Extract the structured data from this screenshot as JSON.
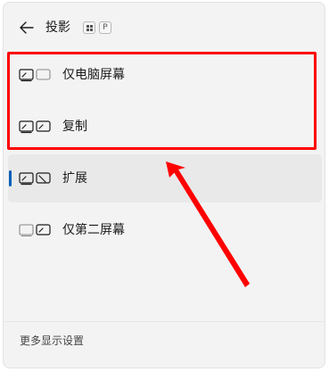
{
  "header": {
    "title": "投影",
    "back_icon": "back-arrow-icon",
    "shortcut_keys": [
      "Win",
      "P"
    ]
  },
  "items": [
    {
      "label": "仅电脑屏幕",
      "icon": "pc-screen-only-icon",
      "selected": false
    },
    {
      "label": "复制",
      "icon": "duplicate-icon",
      "selected": false
    },
    {
      "label": "扩展",
      "icon": "extend-icon",
      "selected": true
    },
    {
      "label": "仅第二屏幕",
      "icon": "second-screen-only-icon",
      "selected": false
    }
  ],
  "footer": {
    "link_label": "更多显示设置"
  },
  "colors": {
    "accent": "#005fb8",
    "annotation": "#ff0000",
    "panel_bg": "#f3f3f3"
  }
}
